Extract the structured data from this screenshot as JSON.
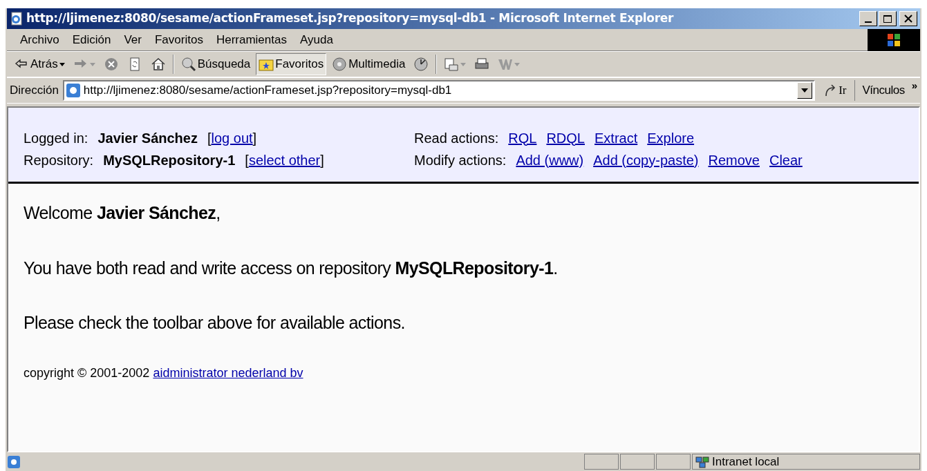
{
  "window": {
    "title": "http://ljimenez:8080/sesame/actionFrameset.jsp?repository=mysql-db1 - Microsoft Internet Explorer"
  },
  "menu": [
    "Archivo",
    "Edición",
    "Ver",
    "Favoritos",
    "Herramientas",
    "Ayuda"
  ],
  "toolbar": [
    {
      "kind": "back",
      "label": "Atrás",
      "selected": false
    },
    {
      "kind": "forward",
      "selected": false
    },
    {
      "kind": "stop",
      "selected": false
    },
    {
      "kind": "refresh",
      "selected": false
    },
    {
      "kind": "home",
      "selected": false
    },
    {
      "kind": "search",
      "label": "Búsqueda",
      "selected": false
    },
    {
      "kind": "favorites",
      "label": "Favoritos",
      "selected": true
    },
    {
      "kind": "media",
      "label": "Multimedia",
      "selected": false
    },
    {
      "kind": "history",
      "selected": false
    },
    {
      "kind": "mail",
      "selected": false
    },
    {
      "kind": "print",
      "selected": false
    },
    {
      "kind": "edit",
      "selected": false
    }
  ],
  "address": {
    "label": "Dirección",
    "value": "http://ljimenez:8080/sesame/actionFrameset.jsp?repository=mysql-db1",
    "go": "Ir",
    "links": "Vínculos",
    "more": "»"
  },
  "header": {
    "left": [
      [
        {
          "kind": "text",
          "text": "Logged in:"
        },
        {
          "kind": "bold",
          "text": "Javier Sánchez"
        },
        {
          "kind": "bracket",
          "text": "["
        },
        {
          "kind": "link",
          "text": "log out"
        },
        {
          "kind": "bracket",
          "text": "]"
        }
      ],
      [
        {
          "kind": "text",
          "text": "Repository:"
        },
        {
          "kind": "bold",
          "text": "MySQLRepository-1"
        },
        {
          "kind": "bracket",
          "text": "["
        },
        {
          "kind": "link",
          "text": "select other"
        },
        {
          "kind": "bracket",
          "text": "]"
        }
      ]
    ],
    "right": [
      [
        {
          "kind": "text",
          "text": "Read actions:"
        },
        {
          "kind": "link",
          "text": "RQL"
        },
        {
          "kind": "link",
          "text": "RDQL"
        },
        {
          "kind": "link",
          "text": "Extract"
        },
        {
          "kind": "link",
          "text": "Explore"
        }
      ],
      [
        {
          "kind": "text",
          "text": "Modify actions:"
        },
        {
          "kind": "link",
          "text": "Add (www)"
        },
        {
          "kind": "link",
          "text": "Add (copy-paste)"
        },
        {
          "kind": "link",
          "text": "Remove"
        },
        {
          "kind": "link",
          "text": "Clear"
        }
      ]
    ]
  },
  "content": {
    "paragraphs": [
      "Welcome **Javier Sánchez**,",
      "You have both read and write access on repository **MySQLRepository-1**.",
      "Please check the toolbar above for available actions."
    ],
    "copyright": "copyright © 2001-2002",
    "copyright_link": "aidministrator nederland bv"
  },
  "status_bar": {
    "zone": "Intranet local"
  }
}
